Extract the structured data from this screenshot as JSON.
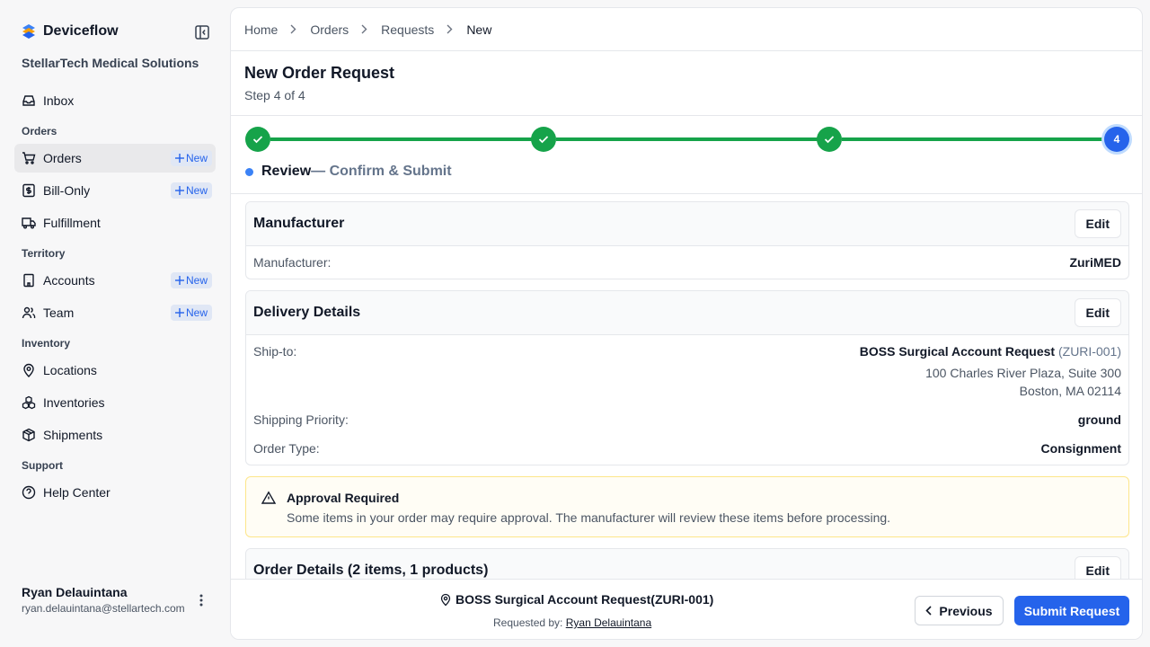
{
  "app": {
    "name": "Deviceflow",
    "org": "StellarTech Medical Solutions"
  },
  "sidebar": {
    "inbox": "Inbox",
    "sections": {
      "orders": "Orders",
      "territory": "Territory",
      "inventory": "Inventory",
      "support": "Support"
    },
    "items": {
      "orders": "Orders",
      "bill_only": "Bill-Only",
      "fulfillment": "Fulfillment",
      "accounts": "Accounts",
      "team": "Team",
      "locations": "Locations",
      "inventories": "Inventories",
      "shipments": "Shipments",
      "help_center": "Help Center"
    },
    "new_label": "New",
    "user": {
      "name": "Ryan Delauintana",
      "email": "ryan.delauintana@stellartech.com"
    }
  },
  "breadcrumb": [
    "Home",
    "Orders",
    "Requests",
    "New"
  ],
  "page": {
    "title": "New Order Request",
    "step": "Step 4 of 4"
  },
  "stepper": {
    "current_number": "4",
    "progress": {
      "current": 4,
      "total": 4
    },
    "label": "Review",
    "sublabel": "— Confirm & Submit"
  },
  "manufacturer_card": {
    "title": "Manufacturer",
    "edit": "Edit",
    "label": "Manufacturer:",
    "value": "ZuriMED"
  },
  "delivery_card": {
    "title": "Delivery Details",
    "edit": "Edit",
    "ship_to_label": "Ship-to:",
    "ship_to_name": "BOSS Surgical Account Request",
    "ship_to_code": "(ZURI-001)",
    "address_line1": "100 Charles River Plaza, Suite 300",
    "address_line2": "Boston, MA 02114",
    "priority_label": "Shipping Priority:",
    "priority_value": "ground",
    "type_label": "Order Type:",
    "type_value": "Consignment"
  },
  "alert": {
    "title": "Approval Required",
    "text": "Some items in your order may require approval. The manufacturer will review these items before processing."
  },
  "order_card": {
    "title": "Order Details (2 items, 1 products)",
    "edit": "Edit"
  },
  "footer": {
    "account": "BOSS Surgical Account Request(ZURI-001)",
    "requested_by_label": "Requested by:",
    "requested_by_name": "Ryan Delauintana",
    "previous": "Previous",
    "submit": "Submit Request"
  },
  "colors": {
    "primary": "#2563eb",
    "success": "#16a34a",
    "warning_border": "#fde68a"
  }
}
